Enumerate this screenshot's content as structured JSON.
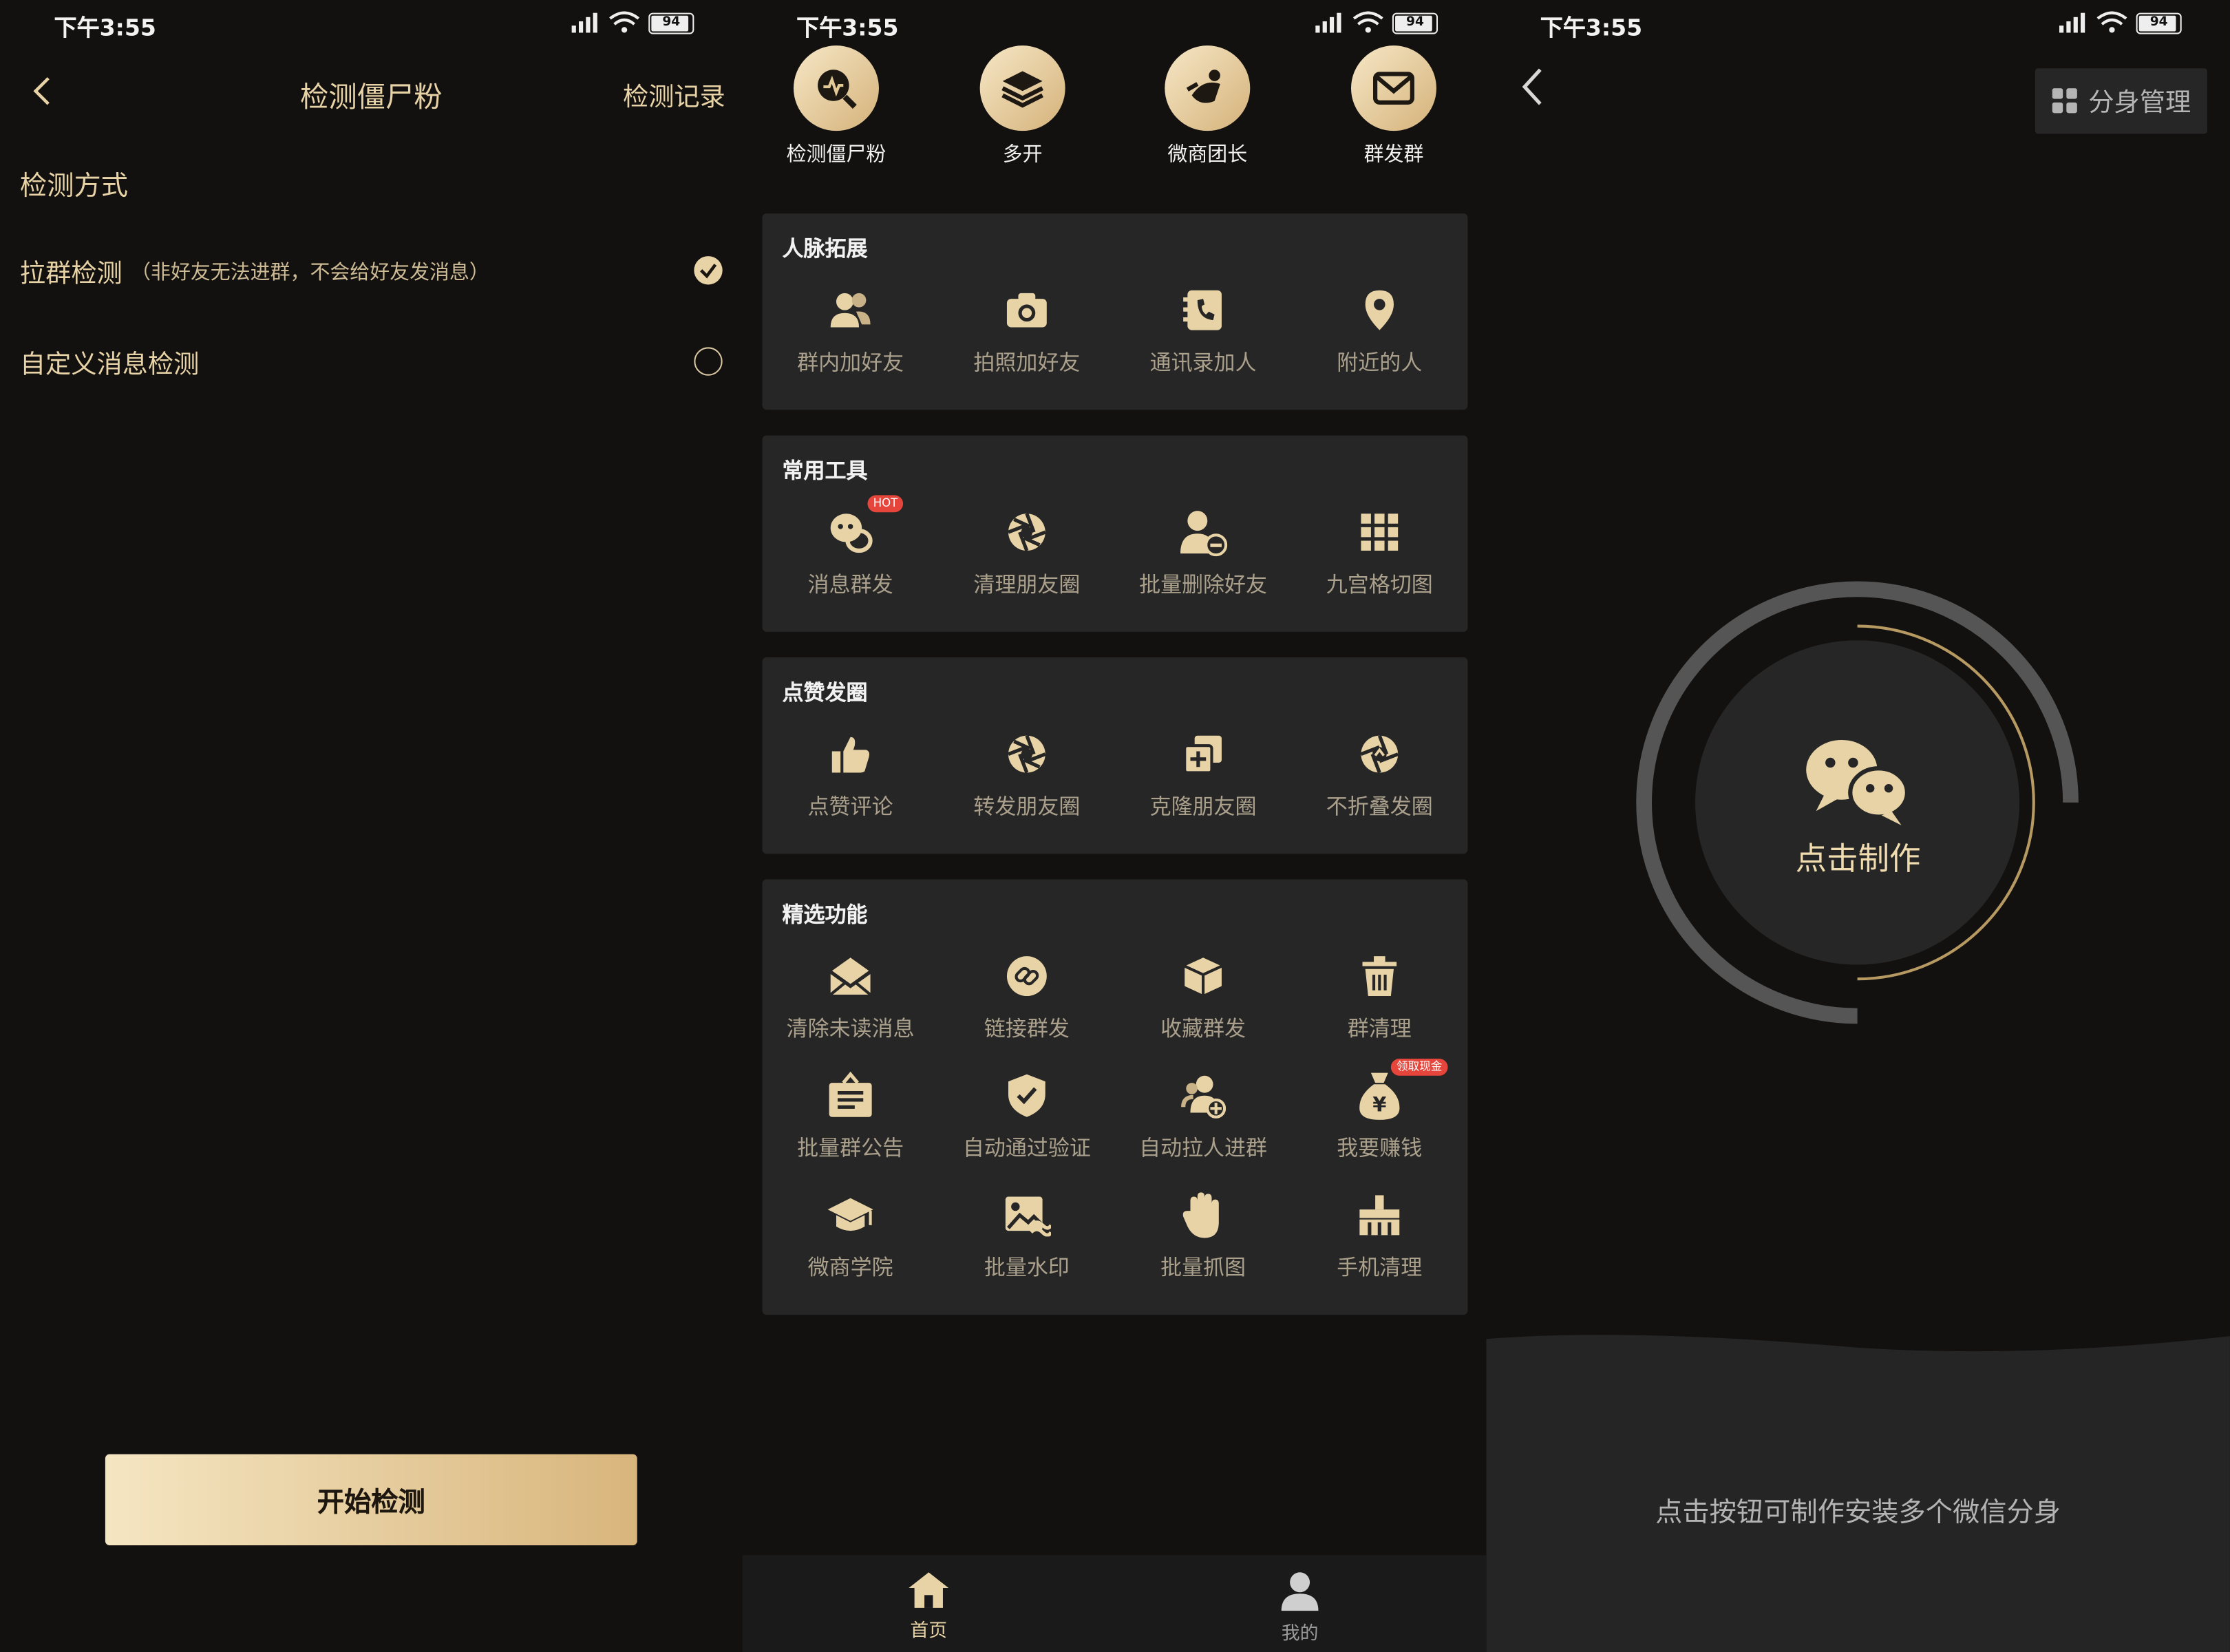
{
  "status": {
    "time": "下午3:55",
    "battery": "94"
  },
  "screen1": {
    "title": "检测僵尸粉",
    "record_link": "检测记录",
    "section_label": "检测方式",
    "options": [
      {
        "label": "拉群检测",
        "note": "（非好友无法进群，不会给好友发消息）",
        "selected": true
      },
      {
        "label": "自定义消息检测",
        "note": "",
        "selected": false
      }
    ],
    "start_button": "开始检测"
  },
  "screen2": {
    "top_icons": [
      {
        "label": "检测僵尸粉",
        "icon": "zombie-detect-icon"
      },
      {
        "label": "多开",
        "icon": "layers-icon"
      },
      {
        "label": "微商团长",
        "icon": "leader-icon"
      },
      {
        "label": "群发群",
        "icon": "mail-icon"
      }
    ],
    "sections": [
      {
        "title": "人脉拓展",
        "items": [
          {
            "label": "群内加好友",
            "icon": "group-friends-icon"
          },
          {
            "label": "拍照加好友",
            "icon": "camera-icon"
          },
          {
            "label": "通讯录加人",
            "icon": "contacts-phone-icon"
          },
          {
            "label": "附近的人",
            "icon": "location-pin-icon"
          }
        ]
      },
      {
        "title": "常用工具",
        "items": [
          {
            "label": "消息群发",
            "icon": "chat-bubbles-icon",
            "tag": "HOT"
          },
          {
            "label": "清理朋友圈",
            "icon": "aperture-icon"
          },
          {
            "label": "批量删除好友",
            "icon": "remove-user-icon"
          },
          {
            "label": "九宫格切图",
            "icon": "grid-icon"
          }
        ]
      },
      {
        "title": "点赞发圈",
        "items": [
          {
            "label": "点赞评论",
            "icon": "thumbs-up-icon"
          },
          {
            "label": "转发朋友圈",
            "icon": "aperture-icon"
          },
          {
            "label": "克隆朋友圈",
            "icon": "clone-icon"
          },
          {
            "label": "不折叠发圈",
            "icon": "aperture-upload-icon"
          }
        ]
      },
      {
        "title": "精选功能",
        "items": [
          {
            "label": "清除未读消息",
            "icon": "envelope-open-icon"
          },
          {
            "label": "链接群发",
            "icon": "link-icon"
          },
          {
            "label": "收藏群发",
            "icon": "box-icon"
          },
          {
            "label": "群清理",
            "icon": "trash-icon"
          },
          {
            "label": "批量群公告",
            "icon": "announcement-icon"
          },
          {
            "label": "自动通过验证",
            "icon": "shield-check-icon"
          },
          {
            "label": "自动拉人进群",
            "icon": "add-group-icon"
          },
          {
            "label": "我要赚钱",
            "icon": "money-bag-icon",
            "tag": "领取现金"
          },
          {
            "label": "微商学院",
            "icon": "graduation-cap-icon"
          },
          {
            "label": "批量水印",
            "icon": "image-watermark-icon"
          },
          {
            "label": "批量抓图",
            "icon": "grab-hand-icon"
          },
          {
            "label": "手机清理",
            "icon": "broom-icon"
          }
        ]
      }
    ],
    "nav": [
      {
        "label": "首页",
        "icon": "home-icon",
        "active": true
      },
      {
        "label": "我的",
        "icon": "user-icon",
        "active": false
      }
    ]
  },
  "screen3": {
    "manage_button": "分身管理",
    "make_label": "点击制作",
    "hint": "点击按钮可制作安装多个微信分身"
  },
  "colors": {
    "gold": "#e8d3a6",
    "background": "#131110",
    "card": "#262626",
    "hot_tag": "#e5453a"
  }
}
